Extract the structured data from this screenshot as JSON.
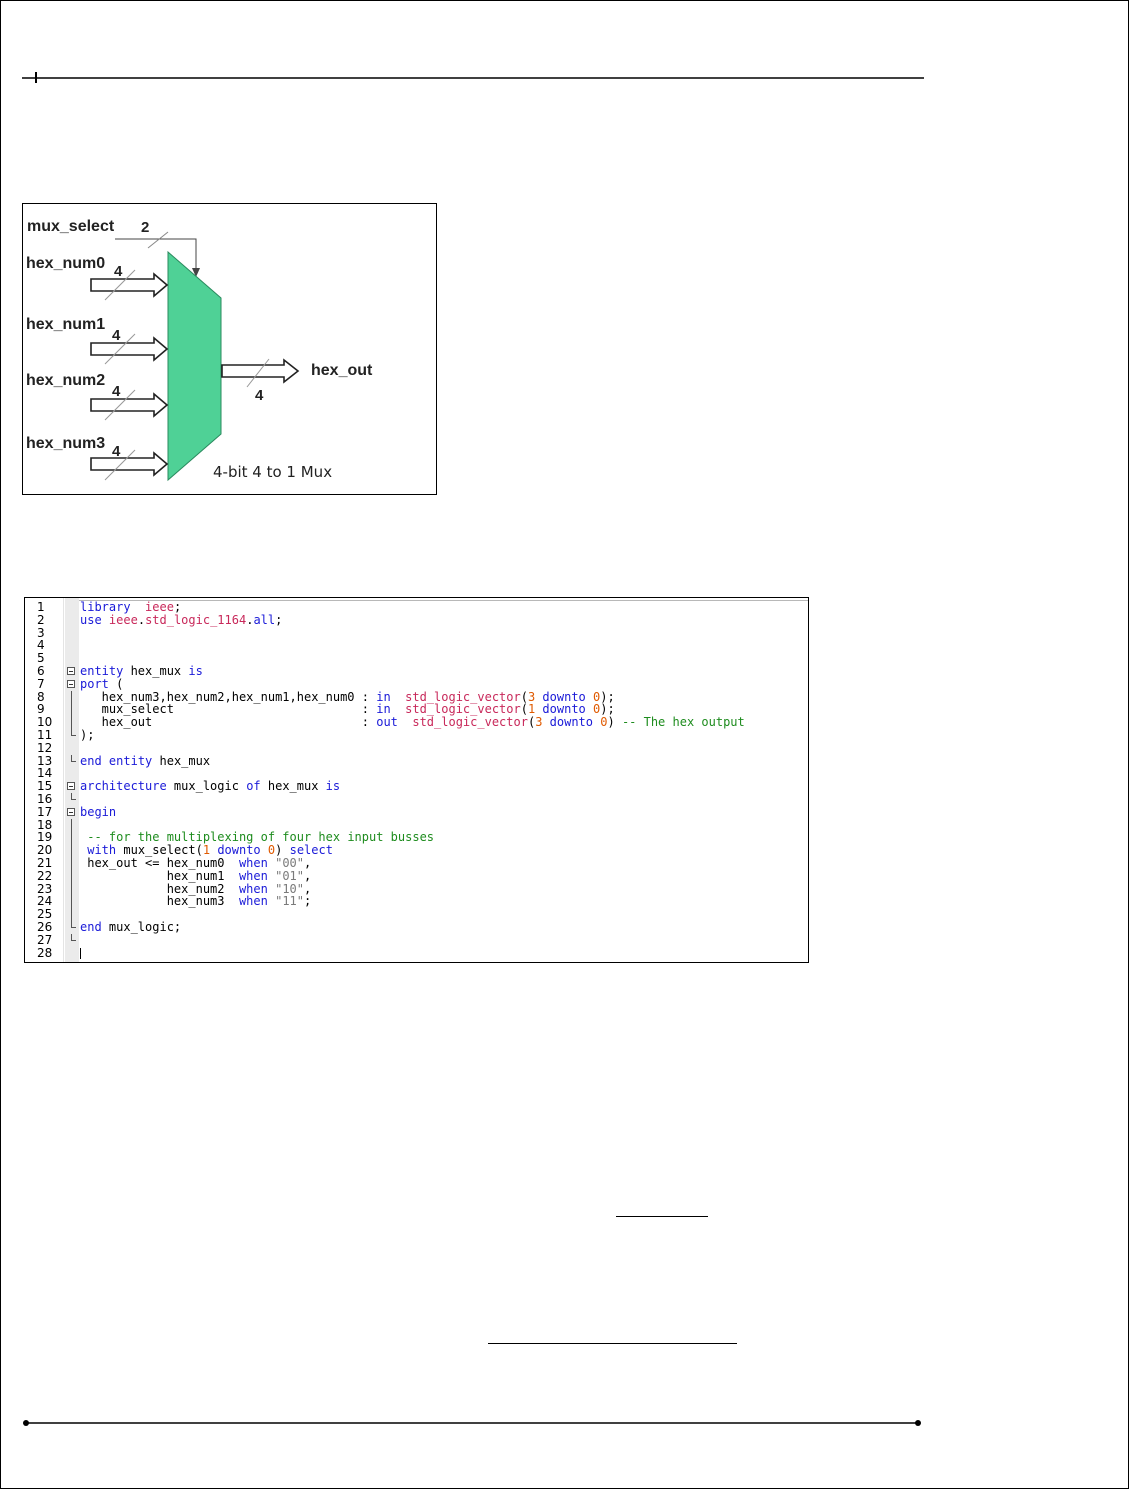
{
  "diagram": {
    "select_label": "mux_select",
    "select_width": "2",
    "inputs": [
      {
        "label": "hex_num0",
        "width": "4"
      },
      {
        "label": "hex_num1",
        "width": "4"
      },
      {
        "label": "hex_num2",
        "width": "4"
      },
      {
        "label": "hex_num3",
        "width": "4"
      }
    ],
    "output_label": "hex_out",
    "output_width": "4",
    "caption": "4-bit 4 to 1 Mux",
    "mux_color": "#4fd196"
  },
  "code": {
    "lines": [
      {
        "n": "1",
        "segs": [
          [
            "kw",
            "library"
          ],
          [
            "",
            "  "
          ],
          [
            "ty",
            "ieee"
          ],
          [
            "",
            ";"
          ]
        ]
      },
      {
        "n": "2",
        "segs": [
          [
            "kw",
            "use"
          ],
          [
            "",
            " "
          ],
          [
            "ty",
            "ieee"
          ],
          [
            "",
            "."
          ],
          [
            "ty",
            "std_logic_1164"
          ],
          [
            "",
            "."
          ],
          [
            "kw",
            "all"
          ],
          [
            "",
            ";"
          ]
        ]
      },
      {
        "n": "3",
        "segs": []
      },
      {
        "n": "4",
        "segs": []
      },
      {
        "n": "5",
        "segs": []
      },
      {
        "n": "6",
        "segs": [
          [
            "kw",
            "entity"
          ],
          [
            "",
            " hex_mux "
          ],
          [
            "kw",
            "is"
          ]
        ]
      },
      {
        "n": "7",
        "segs": [
          [
            "kw",
            "port"
          ],
          [
            "",
            " ("
          ]
        ]
      },
      {
        "n": "8",
        "segs": [
          [
            "",
            "   hex_num3,hex_num2,hex_num1,hex_num0 : "
          ],
          [
            "kw",
            "in"
          ],
          [
            "",
            "  "
          ],
          [
            "ty",
            "std_logic_vector"
          ],
          [
            "",
            "("
          ],
          [
            "nm",
            "3"
          ],
          [
            "",
            " "
          ],
          [
            "kw",
            "downto"
          ],
          [
            "",
            " "
          ],
          [
            "nm",
            "0"
          ],
          [
            "",
            ");"
          ]
        ]
      },
      {
        "n": "9",
        "segs": [
          [
            "",
            "   mux_select                          : "
          ],
          [
            "kw",
            "in"
          ],
          [
            "",
            "  "
          ],
          [
            "ty",
            "std_logic_vector"
          ],
          [
            "",
            "("
          ],
          [
            "nm",
            "1"
          ],
          [
            "",
            " "
          ],
          [
            "kw",
            "downto"
          ],
          [
            "",
            " "
          ],
          [
            "nm",
            "0"
          ],
          [
            "",
            ");"
          ]
        ]
      },
      {
        "n": "10",
        "segs": [
          [
            "",
            "   hex_out                             : "
          ],
          [
            "kw",
            "out"
          ],
          [
            "",
            "  "
          ],
          [
            "ty",
            "std_logic_vector"
          ],
          [
            "",
            "("
          ],
          [
            "nm",
            "3"
          ],
          [
            "",
            " "
          ],
          [
            "kw",
            "downto"
          ],
          [
            "",
            " "
          ],
          [
            "nm",
            "0"
          ],
          [
            "",
            ") "
          ],
          [
            "cm",
            "-- The hex output"
          ]
        ]
      },
      {
        "n": "11",
        "segs": [
          [
            "",
            ");"
          ]
        ]
      },
      {
        "n": "12",
        "segs": []
      },
      {
        "n": "13",
        "segs": [
          [
            "kw",
            "end"
          ],
          [
            "",
            " "
          ],
          [
            "kw",
            "entity"
          ],
          [
            "",
            " hex_mux"
          ]
        ]
      },
      {
        "n": "14",
        "segs": []
      },
      {
        "n": "15",
        "segs": [
          [
            "kw",
            "architecture"
          ],
          [
            "",
            " mux_logic "
          ],
          [
            "kw",
            "of"
          ],
          [
            "",
            " hex_mux "
          ],
          [
            "kw",
            "is"
          ]
        ]
      },
      {
        "n": "16",
        "segs": []
      },
      {
        "n": "17",
        "segs": [
          [
            "kw",
            "begin"
          ]
        ]
      },
      {
        "n": "18",
        "segs": []
      },
      {
        "n": "19",
        "segs": [
          [
            "",
            " "
          ],
          [
            "cm",
            "-- for the multiplexing of four hex input busses"
          ]
        ]
      },
      {
        "n": "20",
        "segs": [
          [
            "",
            " "
          ],
          [
            "kw",
            "with"
          ],
          [
            "",
            " mux_select("
          ],
          [
            "nm",
            "1"
          ],
          [
            "",
            " "
          ],
          [
            "kw",
            "downto"
          ],
          [
            "",
            " "
          ],
          [
            "nm",
            "0"
          ],
          [
            "",
            ") "
          ],
          [
            "kw",
            "select"
          ]
        ]
      },
      {
        "n": "21",
        "segs": [
          [
            "",
            " hex_out <= hex_num0  "
          ],
          [
            "kw",
            "when"
          ],
          [
            "",
            " "
          ],
          [
            "st",
            "\"00\""
          ],
          [
            "",
            ","
          ]
        ]
      },
      {
        "n": "22",
        "segs": [
          [
            "",
            "            hex_num1  "
          ],
          [
            "kw",
            "when"
          ],
          [
            "",
            " "
          ],
          [
            "st",
            "\"01\""
          ],
          [
            "",
            ","
          ]
        ]
      },
      {
        "n": "23",
        "segs": [
          [
            "",
            "            hex_num2  "
          ],
          [
            "kw",
            "when"
          ],
          [
            "",
            " "
          ],
          [
            "st",
            "\"10\""
          ],
          [
            "",
            ","
          ]
        ]
      },
      {
        "n": "24",
        "segs": [
          [
            "",
            "            hex_num3  "
          ],
          [
            "kw",
            "when"
          ],
          [
            "",
            " "
          ],
          [
            "st",
            "\"11\""
          ],
          [
            "",
            ";"
          ]
        ]
      },
      {
        "n": "25",
        "segs": []
      },
      {
        "n": "26",
        "segs": [
          [
            "kw",
            "end"
          ],
          [
            "",
            " mux_logic;"
          ]
        ]
      },
      {
        "n": "27",
        "segs": []
      },
      {
        "n": "28",
        "segs": []
      }
    ]
  }
}
